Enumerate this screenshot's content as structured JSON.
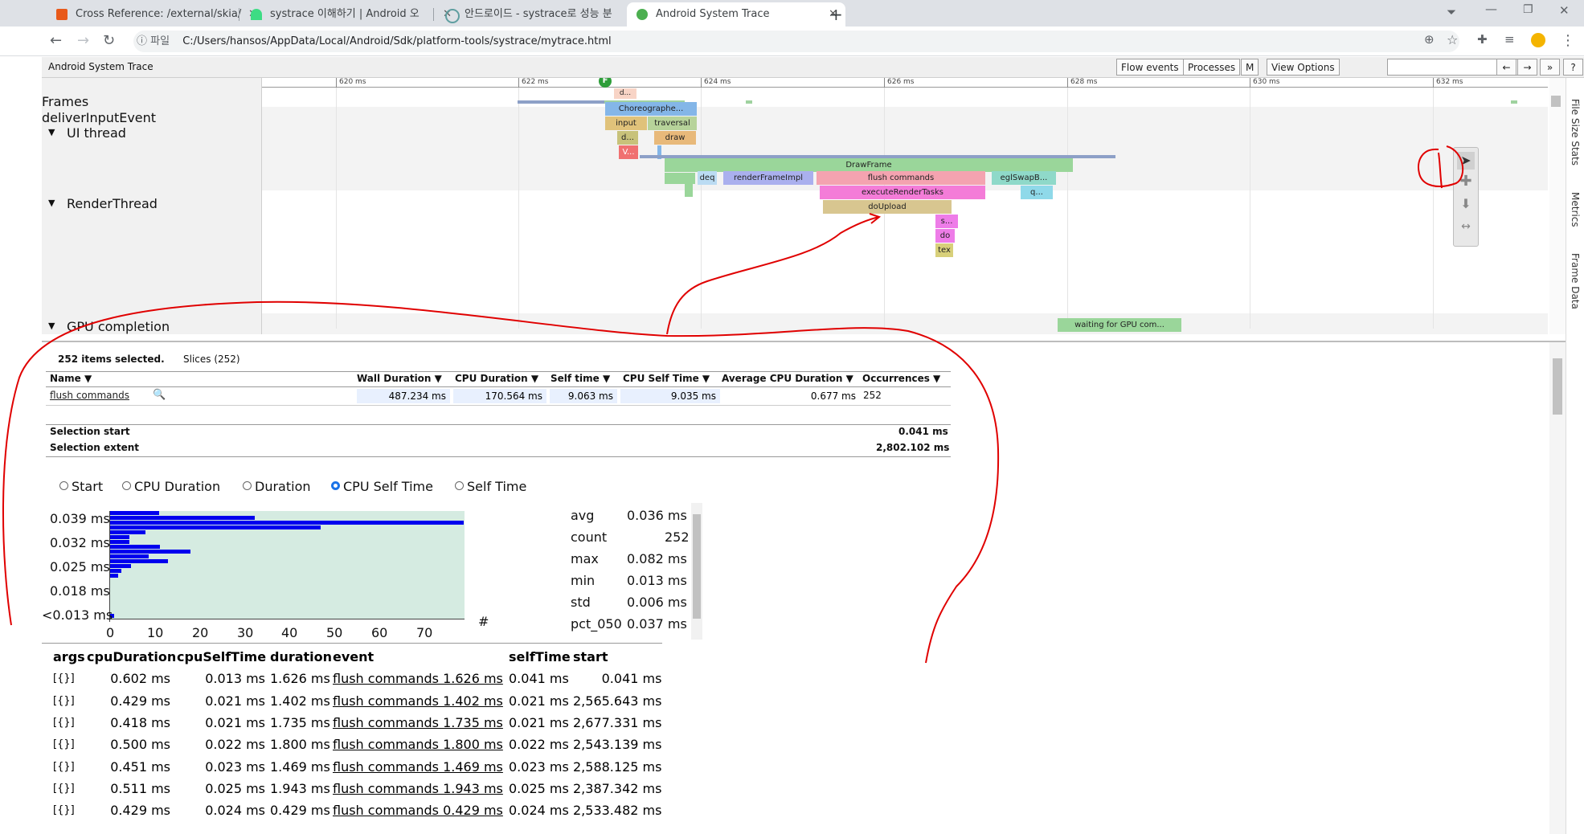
{
  "browser": {
    "tabs": [
      {
        "title": "Cross Reference: /external/skia/",
        "icon": "opengrok-icon",
        "color": "#e8591a"
      },
      {
        "title": "systrace 이해하기  |  Android 오",
        "icon": "android-icon",
        "color": "#3ddc84"
      },
      {
        "title": "안드로이드 - systrace로 성능 분",
        "icon": "loading-icon",
        "color": "#5f9ea0"
      },
      {
        "title": "Android System Trace",
        "icon": "trace-icon",
        "color": "#4caf50"
      }
    ],
    "new_tab": "+",
    "url_prefix": "ⓘ 파일",
    "url": "C:/Users/hansos/AppData/Local/Android/Sdk/platform-tools/systrace/mytrace.html"
  },
  "trace": {
    "title": "Android System Trace",
    "buttons": [
      "Flow events",
      "Processes",
      "M",
      "View Options"
    ],
    "nav": [
      "←",
      "→",
      "»",
      "?"
    ],
    "ticks": [
      "620 ms",
      "622 ms",
      "624 ms",
      "626 ms",
      "628 ms",
      "630 ms",
      "632 ms"
    ],
    "tracks": {
      "frames": "Frames",
      "deliver": "deliverInputEvent",
      "ui": "UI thread",
      "render": "RenderThread",
      "gpu": "GPU completion"
    },
    "frame_marker": "F",
    "ui_slices": [
      "d...",
      "Choreographe...",
      "input",
      "traversal",
      "d...",
      "draw",
      "V..."
    ],
    "render_slices": [
      "DrawFrame",
      "deq",
      "renderFrameImpl",
      "flush commands",
      "eglSwapB...",
      "executeRenderTasks",
      "q...",
      "doUpload",
      "s...",
      "do",
      "tex"
    ],
    "gpu_slice": "waiting for GPU com...",
    "side_tabs": [
      "File Size Stats",
      "Metrics",
      "Frame Data"
    ]
  },
  "analysis": {
    "selected": "252 items selected.",
    "slices_tab": "Slices (252)",
    "columns": [
      "Name ▼",
      "Wall Duration ▼",
      "CPU Duration ▼",
      "Self time ▼",
      "CPU Self Time ▼",
      "Average CPU Duration ▼",
      "Occurrences ▼"
    ],
    "row": {
      "name": "flush commands",
      "wall": "487.234 ms",
      "cpu": "170.564 ms",
      "self": "9.063 ms",
      "cpuself": "9.035 ms",
      "avgcpu": "0.677 ms",
      "occ": "252"
    },
    "sel_start_label": "Selection start",
    "sel_start": "0.041 ms",
    "sel_extent_label": "Selection extent",
    "sel_extent": "2,802.102 ms",
    "radios": [
      "Start",
      "CPU Duration",
      "Duration",
      "CPU Self Time",
      "Self Time"
    ],
    "radio_selected": "CPU Self Time",
    "histogram": {
      "ylabels": [
        "0.039 ms",
        "0.032 ms",
        "0.025 ms",
        "0.018 ms",
        "<0.013 ms"
      ],
      "xlabels": [
        "0",
        "10",
        "20",
        "30",
        "40",
        "50",
        "60",
        "70"
      ],
      "count_label": "#"
    },
    "stats": [
      {
        "k": "avg",
        "v": "0.036 ms"
      },
      {
        "k": "count",
        "v": "252"
      },
      {
        "k": "max",
        "v": "0.082 ms"
      },
      {
        "k": "min",
        "v": "0.013 ms"
      },
      {
        "k": "std",
        "v": "0.006 ms"
      },
      {
        "k": "pct_050",
        "v": "0.037 ms"
      }
    ],
    "table_headers": [
      "args",
      "cpuDuration",
      "cpuSelfTime",
      "duration",
      "event",
      "selfTime",
      "start"
    ],
    "table_rows": [
      [
        "[{}]",
        "0.602 ms",
        "0.013 ms",
        "1.626 ms",
        "flush commands 1.626 ms",
        "0.041 ms",
        "0.041 ms"
      ],
      [
        "[{}]",
        "0.429 ms",
        "0.021 ms",
        "1.402 ms",
        "flush commands 1.402 ms",
        "0.021 ms",
        "2,565.643 ms"
      ],
      [
        "[{}]",
        "0.418 ms",
        "0.021 ms",
        "1.735 ms",
        "flush commands 1.735 ms",
        "0.021 ms",
        "2,677.331 ms"
      ],
      [
        "[{}]",
        "0.500 ms",
        "0.022 ms",
        "1.800 ms",
        "flush commands 1.800 ms",
        "0.022 ms",
        "2,543.139 ms"
      ],
      [
        "[{}]",
        "0.451 ms",
        "0.023 ms",
        "1.469 ms",
        "flush commands 1.469 ms",
        "0.023 ms",
        "2,588.125 ms"
      ],
      [
        "[{}]",
        "0.511 ms",
        "0.025 ms",
        "1.943 ms",
        "flush commands 1.943 ms",
        "0.025 ms",
        "2,387.342 ms"
      ],
      [
        "[{}]",
        "0.429 ms",
        "0.024 ms",
        "0.429 ms",
        "flush commands 0.429 ms",
        "0.024 ms",
        "2,533.482 ms"
      ]
    ]
  },
  "colors": {
    "accent": "#1a73e8",
    "bar": "#0000ee",
    "hist_bg": "#d5ebe1",
    "annotation": "#e00000"
  }
}
